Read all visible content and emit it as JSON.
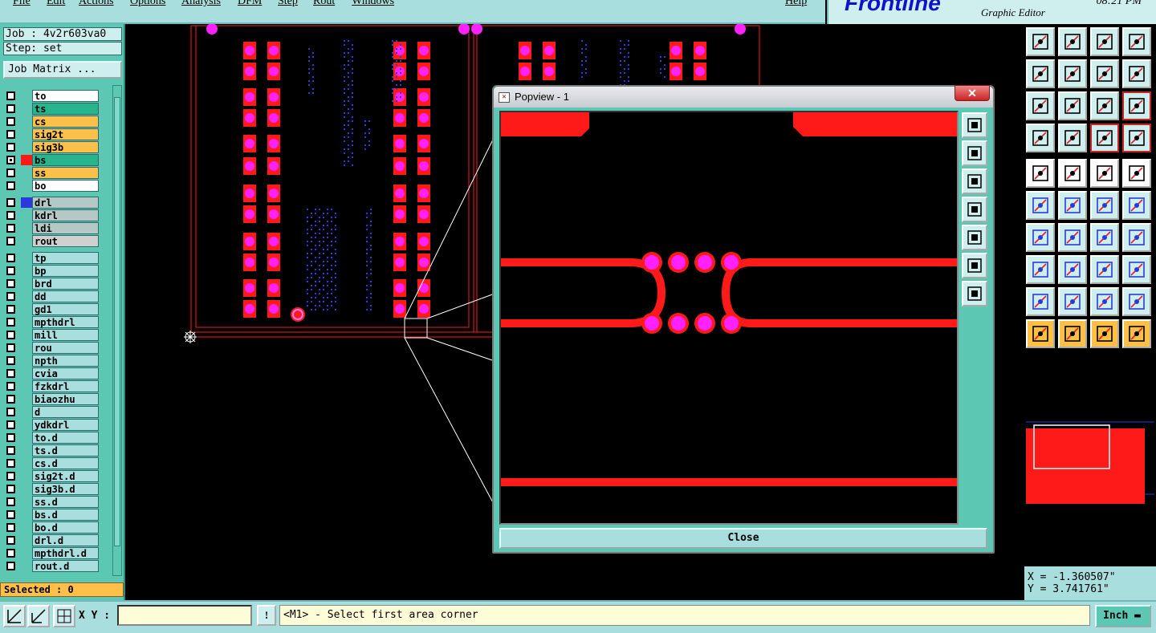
{
  "menu": {
    "items": [
      "File",
      "Edit",
      "Actions",
      "Options",
      "Analysis",
      "DFM",
      "Step",
      "Rout",
      "Windows"
    ],
    "help": "Help"
  },
  "brand": {
    "logo": "Frontline",
    "subtitle": "Graphic Editor",
    "time": "08:21 PM"
  },
  "job": {
    "job_line": "Job : 4v2r603va0",
    "step_line": "Step: set",
    "matrix_button": "Job Matrix ..."
  },
  "layers": [
    {
      "name": "to",
      "bg": "#ffffff",
      "swatch": ""
    },
    {
      "name": "ts",
      "bg": "#28b48c",
      "swatch": ""
    },
    {
      "name": "cs",
      "bg": "#ffc04a",
      "swatch": ""
    },
    {
      "name": "sig2t",
      "bg": "#ffc04a",
      "swatch": ""
    },
    {
      "name": "sig3b",
      "bg": "#ffc04a",
      "swatch": ""
    },
    {
      "name": "bs",
      "bg": "#28b48c",
      "swatch": "#ff1a1a",
      "active": true
    },
    {
      "name": "ss",
      "bg": "#ffc04a",
      "swatch": ""
    },
    {
      "name": "bo",
      "bg": "#ffffff",
      "swatch": ""
    },
    {
      "name": "drl",
      "bg": "#b4c8c8",
      "swatch": "#2a3adc",
      "gap": true
    },
    {
      "name": "kdrl",
      "bg": "#b4c8c8",
      "swatch": ""
    },
    {
      "name": "ldi",
      "bg": "#b4c8c8",
      "swatch": ""
    },
    {
      "name": "rout",
      "bg": "#d0d0d0",
      "swatch": ""
    },
    {
      "name": "tp",
      "bg": "#a8dede",
      "swatch": "",
      "gap": true
    },
    {
      "name": "bp",
      "bg": "#a8dede",
      "swatch": ""
    },
    {
      "name": "brd",
      "bg": "#a8dede",
      "swatch": ""
    },
    {
      "name": "dd",
      "bg": "#a8dede",
      "swatch": ""
    },
    {
      "name": "gd1",
      "bg": "#a8dede",
      "swatch": ""
    },
    {
      "name": "mpthdrl",
      "bg": "#a8dede",
      "swatch": ""
    },
    {
      "name": "mill",
      "bg": "#a8dede",
      "swatch": ""
    },
    {
      "name": "rou",
      "bg": "#a8dede",
      "swatch": ""
    },
    {
      "name": "npth",
      "bg": "#a8dede",
      "swatch": ""
    },
    {
      "name": "cvia",
      "bg": "#a8dede",
      "swatch": ""
    },
    {
      "name": "fzkdrl",
      "bg": "#a8dede",
      "swatch": ""
    },
    {
      "name": "biaozhu",
      "bg": "#a8dede",
      "swatch": ""
    },
    {
      "name": "d",
      "bg": "#a8dede",
      "swatch": ""
    },
    {
      "name": "ydkdrl",
      "bg": "#a8dede",
      "swatch": ""
    },
    {
      "name": "to.d",
      "bg": "#a8dede",
      "swatch": ""
    },
    {
      "name": "ts.d",
      "bg": "#a8dede",
      "swatch": ""
    },
    {
      "name": "cs.d",
      "bg": "#a8dede",
      "swatch": ""
    },
    {
      "name": "sig2t.d",
      "bg": "#a8dede",
      "swatch": ""
    },
    {
      "name": "sig3b.d",
      "bg": "#a8dede",
      "swatch": ""
    },
    {
      "name": "ss.d",
      "bg": "#a8dede",
      "swatch": ""
    },
    {
      "name": "bs.d",
      "bg": "#a8dede",
      "swatch": ""
    },
    {
      "name": "bo.d",
      "bg": "#a8dede",
      "swatch": ""
    },
    {
      "name": "drl.d",
      "bg": "#a8dede",
      "swatch": ""
    },
    {
      "name": "mpthdrl.d",
      "bg": "#a8dede",
      "swatch": ""
    },
    {
      "name": "rout.d",
      "bg": "#a8dede",
      "swatch": ""
    }
  ],
  "selected_text": "Selected : 0",
  "popview": {
    "title": "Popview - 1",
    "close_x": "✕",
    "close_button": "Close"
  },
  "coords": {
    "x": "X = -1.360507\"",
    "y": "Y = 3.741761\""
  },
  "status": {
    "xy_label": "X Y :",
    "xy_value": "",
    "warn": "!",
    "prompt": "<M1> - Select first area corner",
    "units": "Inch"
  },
  "colors": {
    "pad": "#ff1a1a",
    "via": "#ff22ff",
    "drill": "#2a3adc",
    "panel": "#5cc8b4"
  }
}
